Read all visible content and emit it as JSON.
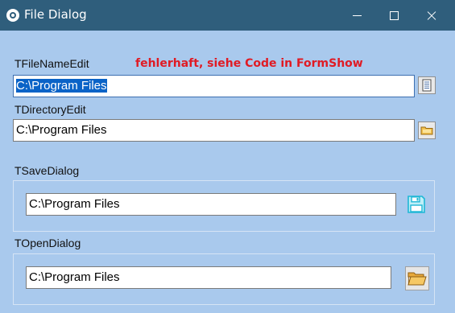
{
  "window": {
    "title": "File Dialog",
    "background_color": "#a9c9ed",
    "titlebar_color": "#2f5e7c",
    "app_icon": "paw-icon",
    "controls": [
      "minimize-icon",
      "maximize-icon",
      "close-icon"
    ]
  },
  "filename_edit": {
    "label": "TFileNameEdit",
    "value": "C:\\Program Files",
    "selected": true,
    "button_icon": "file-list-icon"
  },
  "warning": {
    "text": "fehlerhaft, siehe Code in FormShow",
    "color": "#e01b24"
  },
  "directory_edit": {
    "label": "TDirectoryEdit",
    "value": "C:\\Program Files",
    "button_icon": "folder-small-icon"
  },
  "save_dialog": {
    "label": "TSaveDialog",
    "value": "C:\\Program Files",
    "button_icon": "floppy-disk-icon"
  },
  "open_dialog": {
    "label": "TOpenDialog",
    "value": "C:\\Program Files",
    "button_icon": "open-folder-icon"
  }
}
